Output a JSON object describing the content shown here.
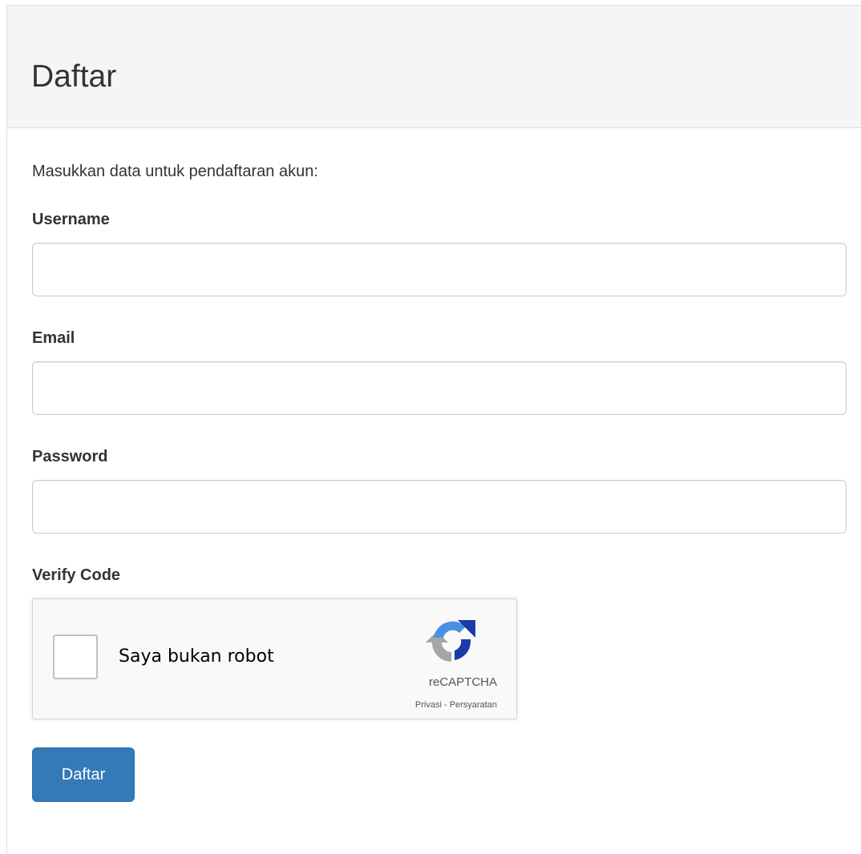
{
  "panel": {
    "title": "Daftar",
    "intro": "Masukkan data untuk pendaftaran akun:"
  },
  "form": {
    "username": {
      "label": "Username",
      "value": "",
      "placeholder": ""
    },
    "email": {
      "label": "Email",
      "value": "",
      "placeholder": ""
    },
    "password": {
      "label": "Password",
      "value": "",
      "placeholder": ""
    },
    "verify": {
      "label": "Verify Code"
    },
    "submit_label": "Daftar"
  },
  "recaptcha": {
    "checkbox_label": "Saya bukan robot",
    "brand": "reCAPTCHA",
    "privacy": "Privasi",
    "separator": " - ",
    "terms": "Persyaratan",
    "icon": "recaptcha-logo-icon",
    "checked": false
  },
  "colors": {
    "primary_button": "#337ab7",
    "heading_bg": "#f5f5f5",
    "border": "#cccccc"
  }
}
